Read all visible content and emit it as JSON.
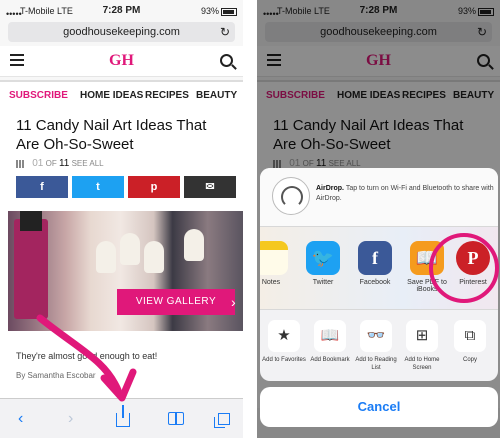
{
  "status": {
    "carrier": "T-Mobile  LTE",
    "time": "7:28 PM",
    "battery": "93%"
  },
  "browser": {
    "url": "goodhousekeeping.com"
  },
  "site": {
    "logo": "GH",
    "nav": [
      "SUBSCRIBE",
      "HOME IDEAS",
      "RECIPES",
      "BEAUTY"
    ]
  },
  "article": {
    "headline": "11 Candy Nail Art Ideas That Are Oh-So-Sweet",
    "pager": {
      "current": "01",
      "of": "OF",
      "total": "11",
      "see_all": "SEE ALL"
    },
    "gallery_button": "VIEW GALLERY",
    "caption": "They're almost good enough to eat!",
    "byline": "By Samantha Escobar"
  },
  "share_sheet": {
    "airdrop_title": "AirDrop.",
    "airdrop_text": "Tap to turn on Wi-Fi and Bluetooth to share with AirDrop.",
    "apps": [
      {
        "label": "Notes",
        "icon": "notes-icon"
      },
      {
        "label": "Twitter",
        "icon": "twitter-icon"
      },
      {
        "label": "Facebook",
        "icon": "facebook-icon"
      },
      {
        "label": "Save PDF to iBooks",
        "icon": "ibooks-icon"
      },
      {
        "label": "Pinterest",
        "icon": "pinterest-icon"
      }
    ],
    "actions": [
      {
        "label": "Add to Favorites",
        "icon": "star-icon"
      },
      {
        "label": "Add Bookmark",
        "icon": "book-icon"
      },
      {
        "label": "Add to Reading List",
        "icon": "glasses-icon"
      },
      {
        "label": "Add to Home Screen",
        "icon": "plus-square-icon"
      },
      {
        "label": "Copy",
        "icon": "copy-icon"
      }
    ],
    "cancel": "Cancel"
  },
  "colors": {
    "brand": "#e0187a",
    "ios_blue": "#1a7cf5"
  }
}
